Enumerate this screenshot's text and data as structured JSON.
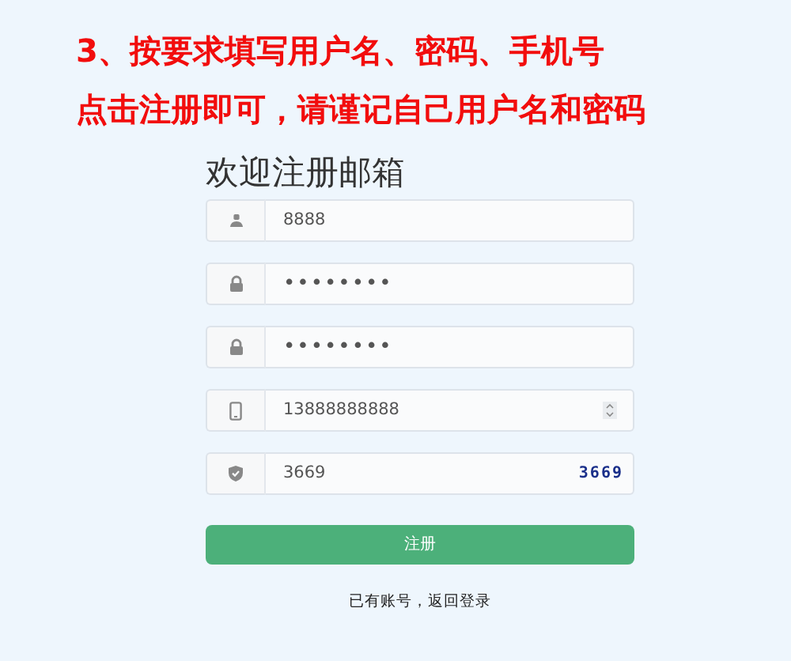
{
  "instructions": [
    "3、按要求填写用户名、密码、手机号",
    "点击注册即可，请谨记自己用户名和密码"
  ],
  "form": {
    "title": "欢迎注册邮箱",
    "fields": [
      {
        "kind": "user",
        "value": "8888"
      },
      {
        "kind": "password",
        "value": "••••••••"
      },
      {
        "kind": "password",
        "value": "••••••••"
      },
      {
        "kind": "phone",
        "value": "13888888888"
      },
      {
        "kind": "captcha",
        "value": "3669",
        "code": "3669"
      }
    ],
    "submit": "注册",
    "login_link": "已有账号，返回登录"
  }
}
